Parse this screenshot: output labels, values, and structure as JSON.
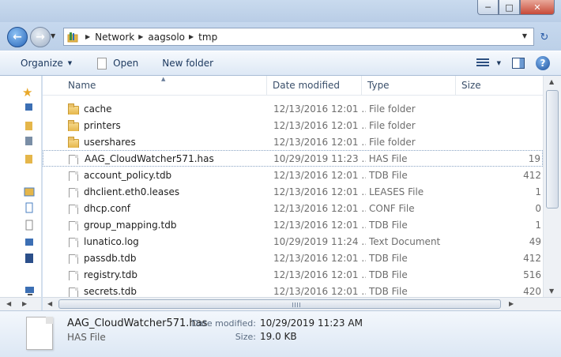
{
  "address": {
    "breadcrumbs": [
      "Network",
      "aagsolo",
      "tmp"
    ]
  },
  "toolbar": {
    "organize_label": "Organize",
    "open_label": "Open",
    "new_folder_label": "New folder"
  },
  "columns": {
    "name": "Name",
    "date": "Date modified",
    "type": "Type",
    "size": "Size"
  },
  "files": [
    {
      "name": "cache",
      "date": "12/13/2016 12:01 ...",
      "type": "File folder",
      "size": "",
      "kind": "folder"
    },
    {
      "name": "printers",
      "date": "12/13/2016 12:01 ...",
      "type": "File folder",
      "size": "",
      "kind": "folder"
    },
    {
      "name": "usershares",
      "date": "12/13/2016 12:01 ...",
      "type": "File folder",
      "size": "",
      "kind": "folder"
    },
    {
      "name": "AAG_CloudWatcher571.has",
      "date": "10/29/2019 11:23 ...",
      "type": "HAS File",
      "size": "19",
      "kind": "file",
      "selected": true
    },
    {
      "name": "account_policy.tdb",
      "date": "12/13/2016 12:01 ...",
      "type": "TDB File",
      "size": "412",
      "kind": "file"
    },
    {
      "name": "dhclient.eth0.leases",
      "date": "12/13/2016 12:01 ...",
      "type": "LEASES File",
      "size": "1",
      "kind": "file"
    },
    {
      "name": "dhcp.conf",
      "date": "12/13/2016 12:01 ...",
      "type": "CONF File",
      "size": "0",
      "kind": "file"
    },
    {
      "name": "group_mapping.tdb",
      "date": "12/13/2016 12:01 ...",
      "type": "TDB File",
      "size": "1",
      "kind": "file"
    },
    {
      "name": "lunatico.log",
      "date": "10/29/2019 11:24 ...",
      "type": "Text Document",
      "size": "49",
      "kind": "file"
    },
    {
      "name": "passdb.tdb",
      "date": "12/13/2016 12:01 ...",
      "type": "TDB File",
      "size": "412",
      "kind": "file"
    },
    {
      "name": "registry.tdb",
      "date": "12/13/2016 12:01 ...",
      "type": "TDB File",
      "size": "516",
      "kind": "file"
    },
    {
      "name": "secrets.tdb",
      "date": "12/13/2016 12:01 ...",
      "type": "TDB File",
      "size": "420",
      "kind": "file"
    }
  ],
  "details": {
    "name": "AAG_CloudWatcher571.has",
    "type": "HAS File",
    "date_label": "Date modified:",
    "date_value": "10/29/2019 11:23 AM",
    "size_label": "Size:",
    "size_value": "19.0 KB"
  },
  "colors": {
    "chrome": "#cfdef0",
    "accent": "#2865b8",
    "folder": "#e5b64a"
  }
}
